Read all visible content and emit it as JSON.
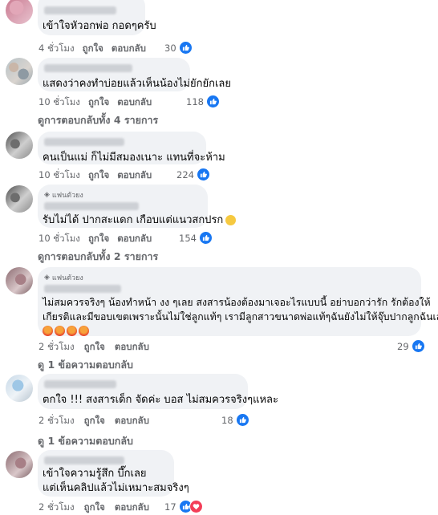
{
  "actions": {
    "like": "ถูกใจ",
    "reply": "ตอบกลับ"
  },
  "comments": [
    {
      "text": [
        "เข้าใจหัวอกพ่อ กอดๆครับ"
      ],
      "time": "4 ชั่วโมง",
      "reactions": "30"
    },
    {
      "text": [
        "แสดงว่าคงทำบ่อยแล้วเห็นน้องไม่ยักยักเลย"
      ],
      "time": "10 ชั่วโมง",
      "reactions": "118",
      "replies": "ดูการตอบกลับทั้ง 4 รายการ"
    },
    {
      "text": [
        "คนเป็นแม่ ก็ไม่มีสมองเนาะ แทนที่จะห้าม"
      ],
      "time": "10 ชั่วโมง",
      "reactions": "224"
    },
    {
      "badge": "แฟนตัวยง",
      "text": [
        "รับไม่ได้ ปากสะแดก เกือบแต่แนวสกปรก"
      ],
      "time": "10 ชั่วโมง",
      "reactions": "154",
      "replies": "ดูการตอบกลับทั้ง 2 รายการ"
    },
    {
      "badge": "แฟนตัวยง",
      "text": [
        "ไม่สมควรจริงๆ น้องทำหน้า งง ๆเลย สงสารน้องต้องมาเจอะไรแบบนี้ อย่าบอกว่ารัก รักต้องให้",
        "เกียรติและมีขอบเขตเพราะนั้นไม่ใช่ลูกแท้ๆ เรามีลูกสาวขนาดพ่อแท้ๆฉันยังไม่ให้จุ๊บปากลูกฉันเลย"
      ],
      "time": "2 ชั่วโมง",
      "reactions": "29",
      "replies": "ดู 1 ข้อความตอบกลับ"
    },
    {
      "text": [
        "ตกใจ !!! สงสารเด็ก จัดค่ะ บอส ไม่สมควรจริงๆแหละ"
      ],
      "time": "2 ชั่วโมง",
      "reactions": "18",
      "replies": "ดู 1 ข้อความตอบกลับ"
    },
    {
      "text": [
        "เข้าใจความรู้สึก บึ๊กเลย",
        "แต่เห็นคลิปแล้วไม่เหมาะสมจริงๆ"
      ],
      "time": "2 ชั่วโมง",
      "reactions": "17"
    }
  ],
  "icons": {
    "like": "thumbs-up-icon",
    "love": "heart-icon",
    "angry": "angry-emoji",
    "plead": "pleading-emoji",
    "badge": "diamond-icon"
  },
  "colors": {
    "bubble": "#f0f2f5",
    "like": "#1877f2",
    "love": "#f33e58",
    "meta": "#65676b"
  }
}
